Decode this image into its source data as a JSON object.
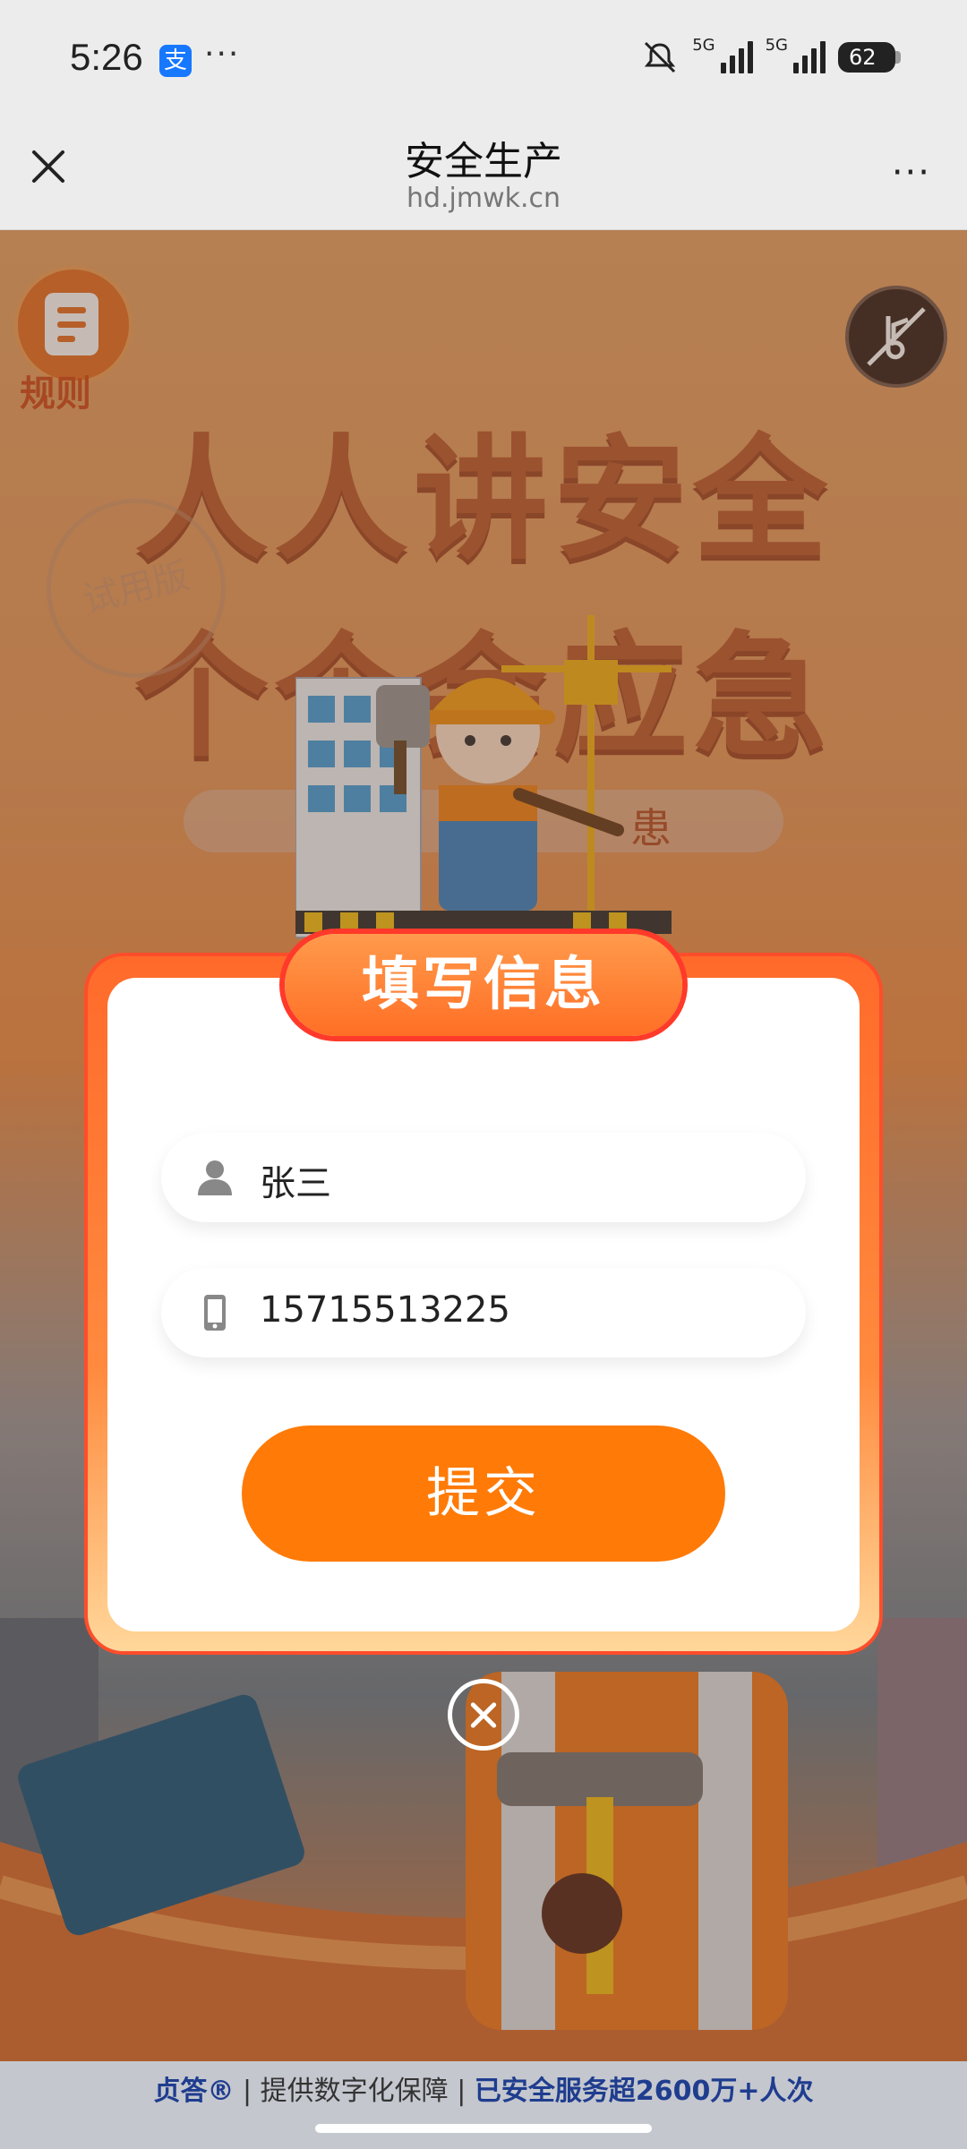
{
  "status_bar": {
    "time": "5:26",
    "app_badge": "支",
    "dots": "···",
    "network_1": "5G",
    "network_2": "5G",
    "battery": "62"
  },
  "nav": {
    "title": "安全生产",
    "domain": "hd.jmwk.cn",
    "more": "···"
  },
  "hero": {
    "rules_label": "规则",
    "headline_1": "人人讲安全",
    "headline_2": "个个会应急",
    "stamp": "试用版",
    "pill_text": "患"
  },
  "modal": {
    "title": "填写信息",
    "name_value": "张三",
    "phone_value": "15715513225",
    "submit_label": "提交"
  },
  "footer": {
    "brand": "贞答®",
    "separator": "|",
    "text1": "提供数字化保障",
    "text2": "已安全服务超2600万+人次"
  },
  "colors": {
    "accent": "#ff7a06",
    "modal_border": "#ff4d2a",
    "brand_blue": "#1f3d8f"
  },
  "icons": {
    "name": "person-icon",
    "phone": "phone-icon",
    "close": "close-icon",
    "rules": "document-icon",
    "music": "music-off-icon"
  }
}
